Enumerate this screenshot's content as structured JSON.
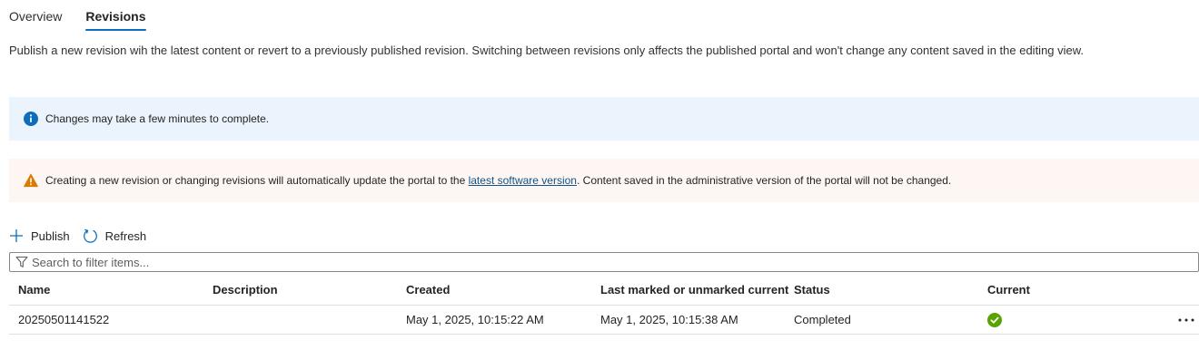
{
  "tabs": [
    {
      "label": "Overview",
      "active": false
    },
    {
      "label": "Revisions",
      "active": true
    }
  ],
  "description": "Publish a new revision wih the latest content or revert to a previously published revision. Switching between revisions only affects the published portal and won't change any content saved in the editing view.",
  "info_bar": {
    "icon": "info-icon",
    "text": "Changes may take a few minutes to complete."
  },
  "warning_bar": {
    "icon": "warning-icon",
    "text_before": "Creating a new revision or changing revisions will automatically update the portal to the ",
    "link": "latest software version",
    "text_after": ". Content saved in the administrative version of the portal will not be changed."
  },
  "toolbar": {
    "publish_label": "Publish",
    "refresh_label": "Refresh"
  },
  "search": {
    "placeholder": "Search to filter items...",
    "value": ""
  },
  "table": {
    "columns": [
      "Name",
      "Description",
      "Created",
      "Last marked or unmarked current",
      "Status",
      "Current"
    ],
    "rows": [
      {
        "name": "20250501141522",
        "description": "",
        "created": "May 1, 2025, 10:15:22 AM",
        "last_marked": "May 1, 2025, 10:15:38 AM",
        "status": "Completed",
        "current": true
      }
    ]
  },
  "colors": {
    "accent": "#0f6cbd",
    "info_bg": "#ebf3fc",
    "warning_bg": "#fdf6f3",
    "warning_icon": "#da7b00",
    "success": "#57a300"
  }
}
